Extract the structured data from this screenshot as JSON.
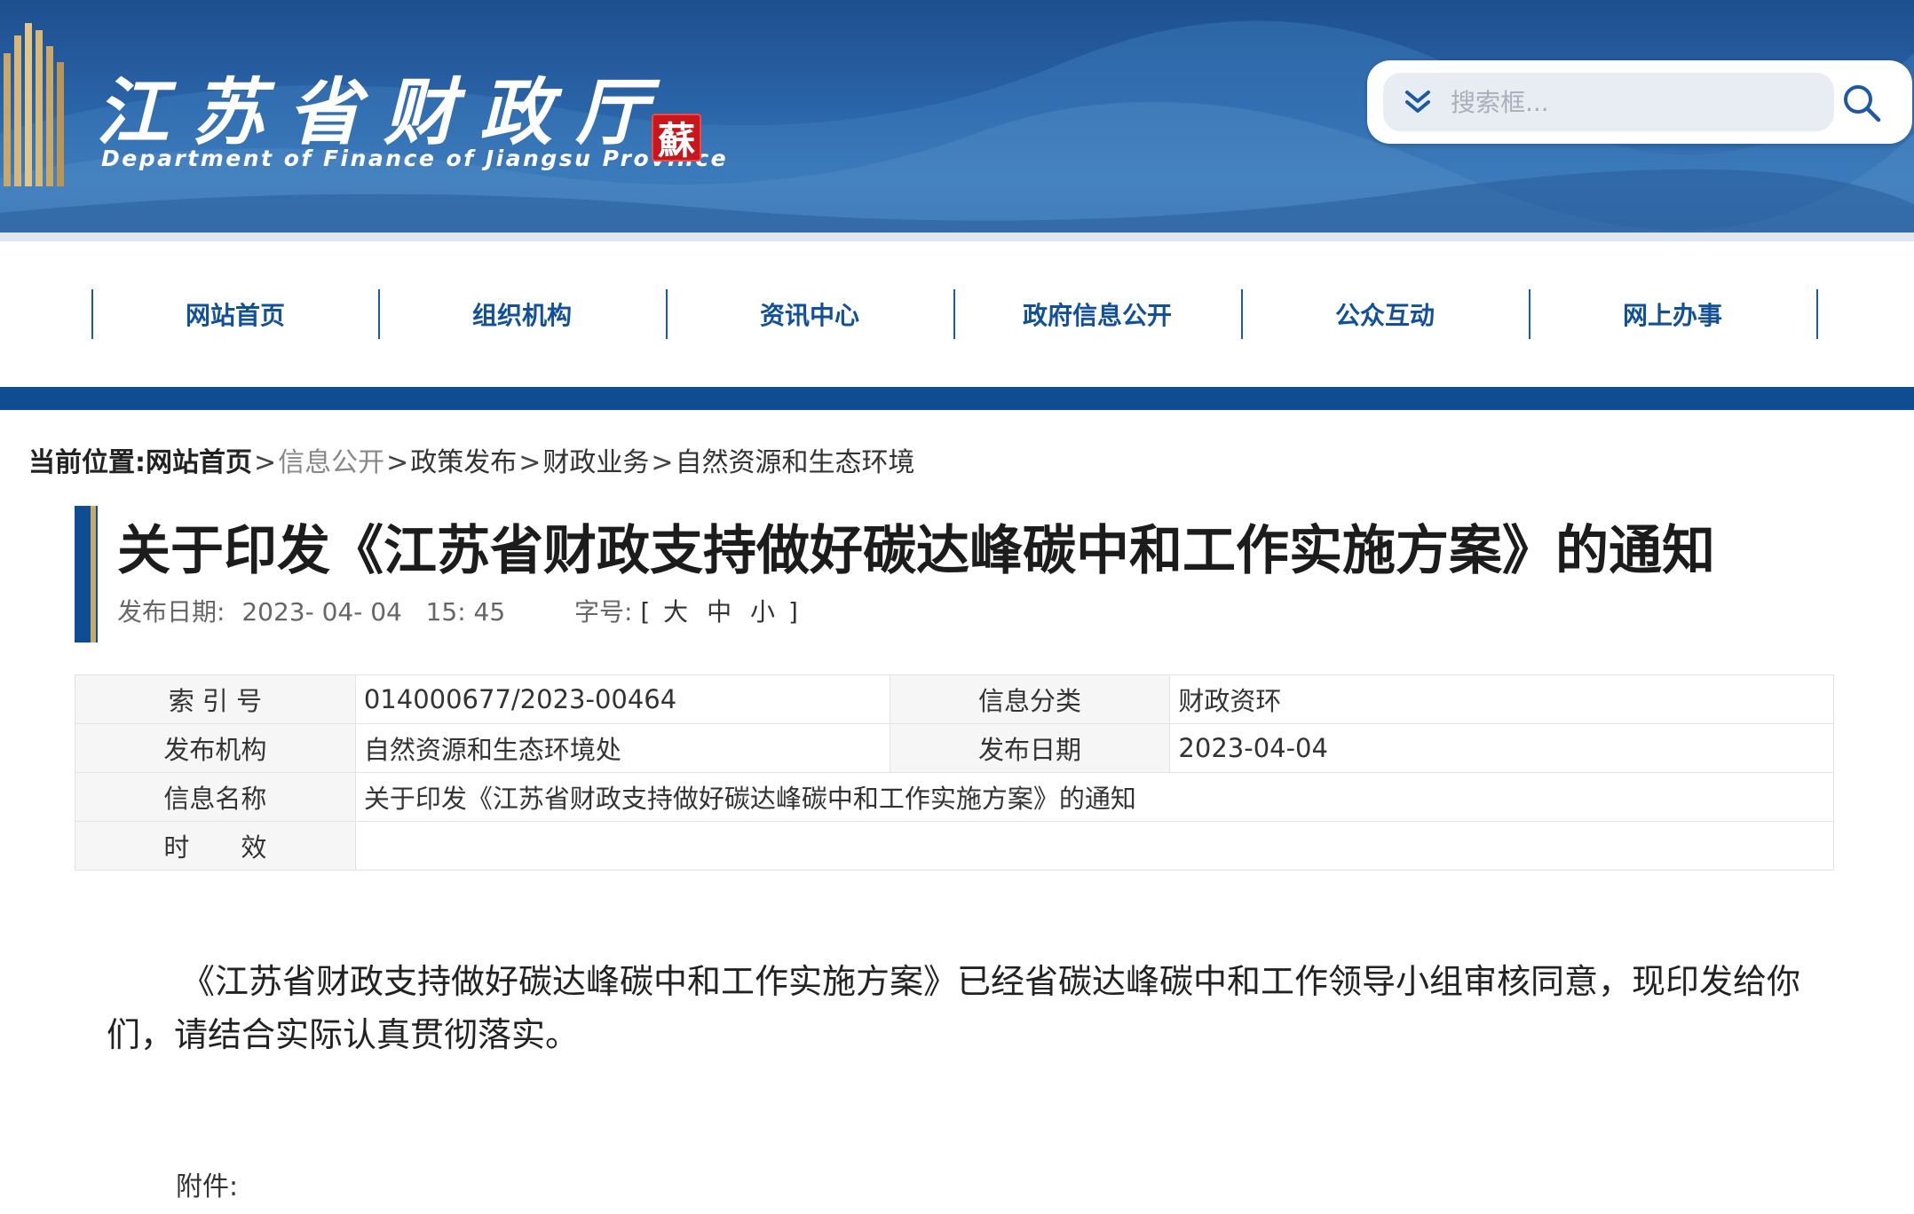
{
  "header": {
    "site_title": "江苏省财政厅",
    "site_subtitle": "Department of Finance of Jiangsu Province",
    "seal_char": "蘇",
    "search_placeholder": "搜索框...",
    "colors": {
      "banner": "#2a64a8",
      "seal": "#c8161d"
    }
  },
  "nav": {
    "items": [
      {
        "label": "网站首页"
      },
      {
        "label": "组织机构"
      },
      {
        "label": "资讯中心"
      },
      {
        "label": "政府信息公开"
      },
      {
        "label": "公众互动"
      },
      {
        "label": "网上办事"
      }
    ],
    "colors": {
      "text": "#12509a",
      "bar": "#0f4c91"
    }
  },
  "breadcrumb": {
    "label": "当前位置:",
    "items": [
      "网站首页",
      "信息公开",
      "政策发布",
      "财政业务",
      "自然资源和生态环境"
    ],
    "separator": ">"
  },
  "article": {
    "title": "关于印发《江苏省财政支持做好碳达峰碳中和工作实施方案》的通知",
    "date_label": "发布日期:",
    "date_value": "2023- 04- 04   15: 45",
    "font_size_label": "字号:",
    "font_size_open": "[",
    "font_size_options": [
      "大",
      "中",
      "小"
    ],
    "font_size_close": "]",
    "body": "《江苏省财政支持做好碳达峰碳中和工作实施方案》已经省碳达峰碳中和工作领导小组审核同意，现印发给你们，请结合实际认真贯彻落实。",
    "attachment_label": "附件:"
  },
  "info_table": {
    "index_label": "索 引 号",
    "index_value": "014000677/2023-00464",
    "category_label": "信息分类",
    "category_value": "财政资环",
    "publisher_label": "发布机构",
    "publisher_value": "自然资源和生态环境处",
    "pubdate_label": "发布日期",
    "pubdate_value": "2023-04-04",
    "name_label": "信息名称",
    "name_value": "关于印发《江苏省财政支持做好碳达峰碳中和工作实施方案》的通知",
    "validity_label": "时　　效",
    "validity_value": ""
  }
}
